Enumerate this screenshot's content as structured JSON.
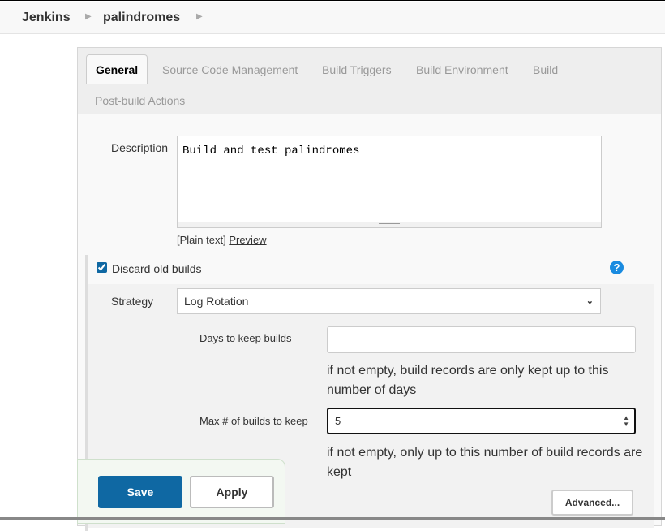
{
  "breadcrumb": [
    "Jenkins",
    "palindromes"
  ],
  "tabs": [
    "General",
    "Source Code Management",
    "Build Triggers",
    "Build Environment",
    "Build",
    "Post-build Actions"
  ],
  "general": {
    "description_label": "Description",
    "description_value": "Build and test palindromes",
    "plain_text": "[Plain text]",
    "preview_link": "Preview",
    "discard_label": "Discard old builds",
    "discard_checked": true,
    "help_icon": "question-circle-icon",
    "strategy_label": "Strategy",
    "strategy_value": "Log Rotation",
    "days_label": "Days to keep builds",
    "days_value": "",
    "days_help": "if not empty, build records are only kept up to this number of days",
    "max_label": "Max # of builds to keep",
    "max_value": "5",
    "max_help": "if not empty, only up to this number of build records are kept",
    "advanced_label": "Advanced..."
  },
  "actions": {
    "save": "Save",
    "apply": "Apply"
  },
  "colors": {
    "primary": "#0f68a3",
    "help": "#1a8be0"
  }
}
